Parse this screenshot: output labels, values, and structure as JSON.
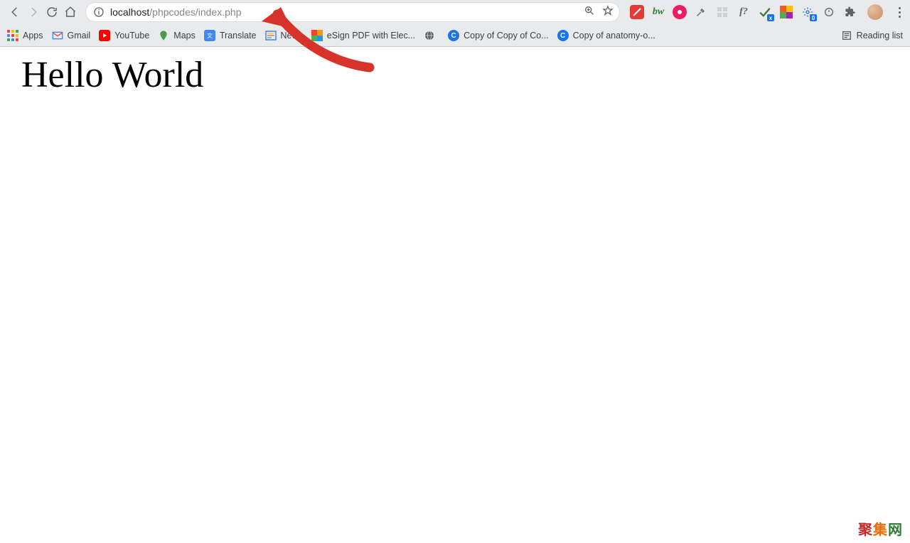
{
  "url": {
    "host": "localhost",
    "path": "/phpcodes/index.php"
  },
  "bookmarks": {
    "apps": "Apps",
    "items": [
      {
        "label": "Gmail"
      },
      {
        "label": "YouTube"
      },
      {
        "label": "Maps"
      },
      {
        "label": "Translate"
      },
      {
        "label": "News"
      },
      {
        "label": "eSign PDF with Elec..."
      },
      {
        "label": ""
      },
      {
        "label": "Copy of Copy of Co..."
      },
      {
        "label": "Copy of anatomy-o..."
      }
    ],
    "reading_list": "Reading list"
  },
  "extensions": {
    "badge_zero": "0",
    "badge_x": "x",
    "question": "?"
  },
  "page": {
    "heading": "Hello World",
    "watermark": "聚集网"
  }
}
